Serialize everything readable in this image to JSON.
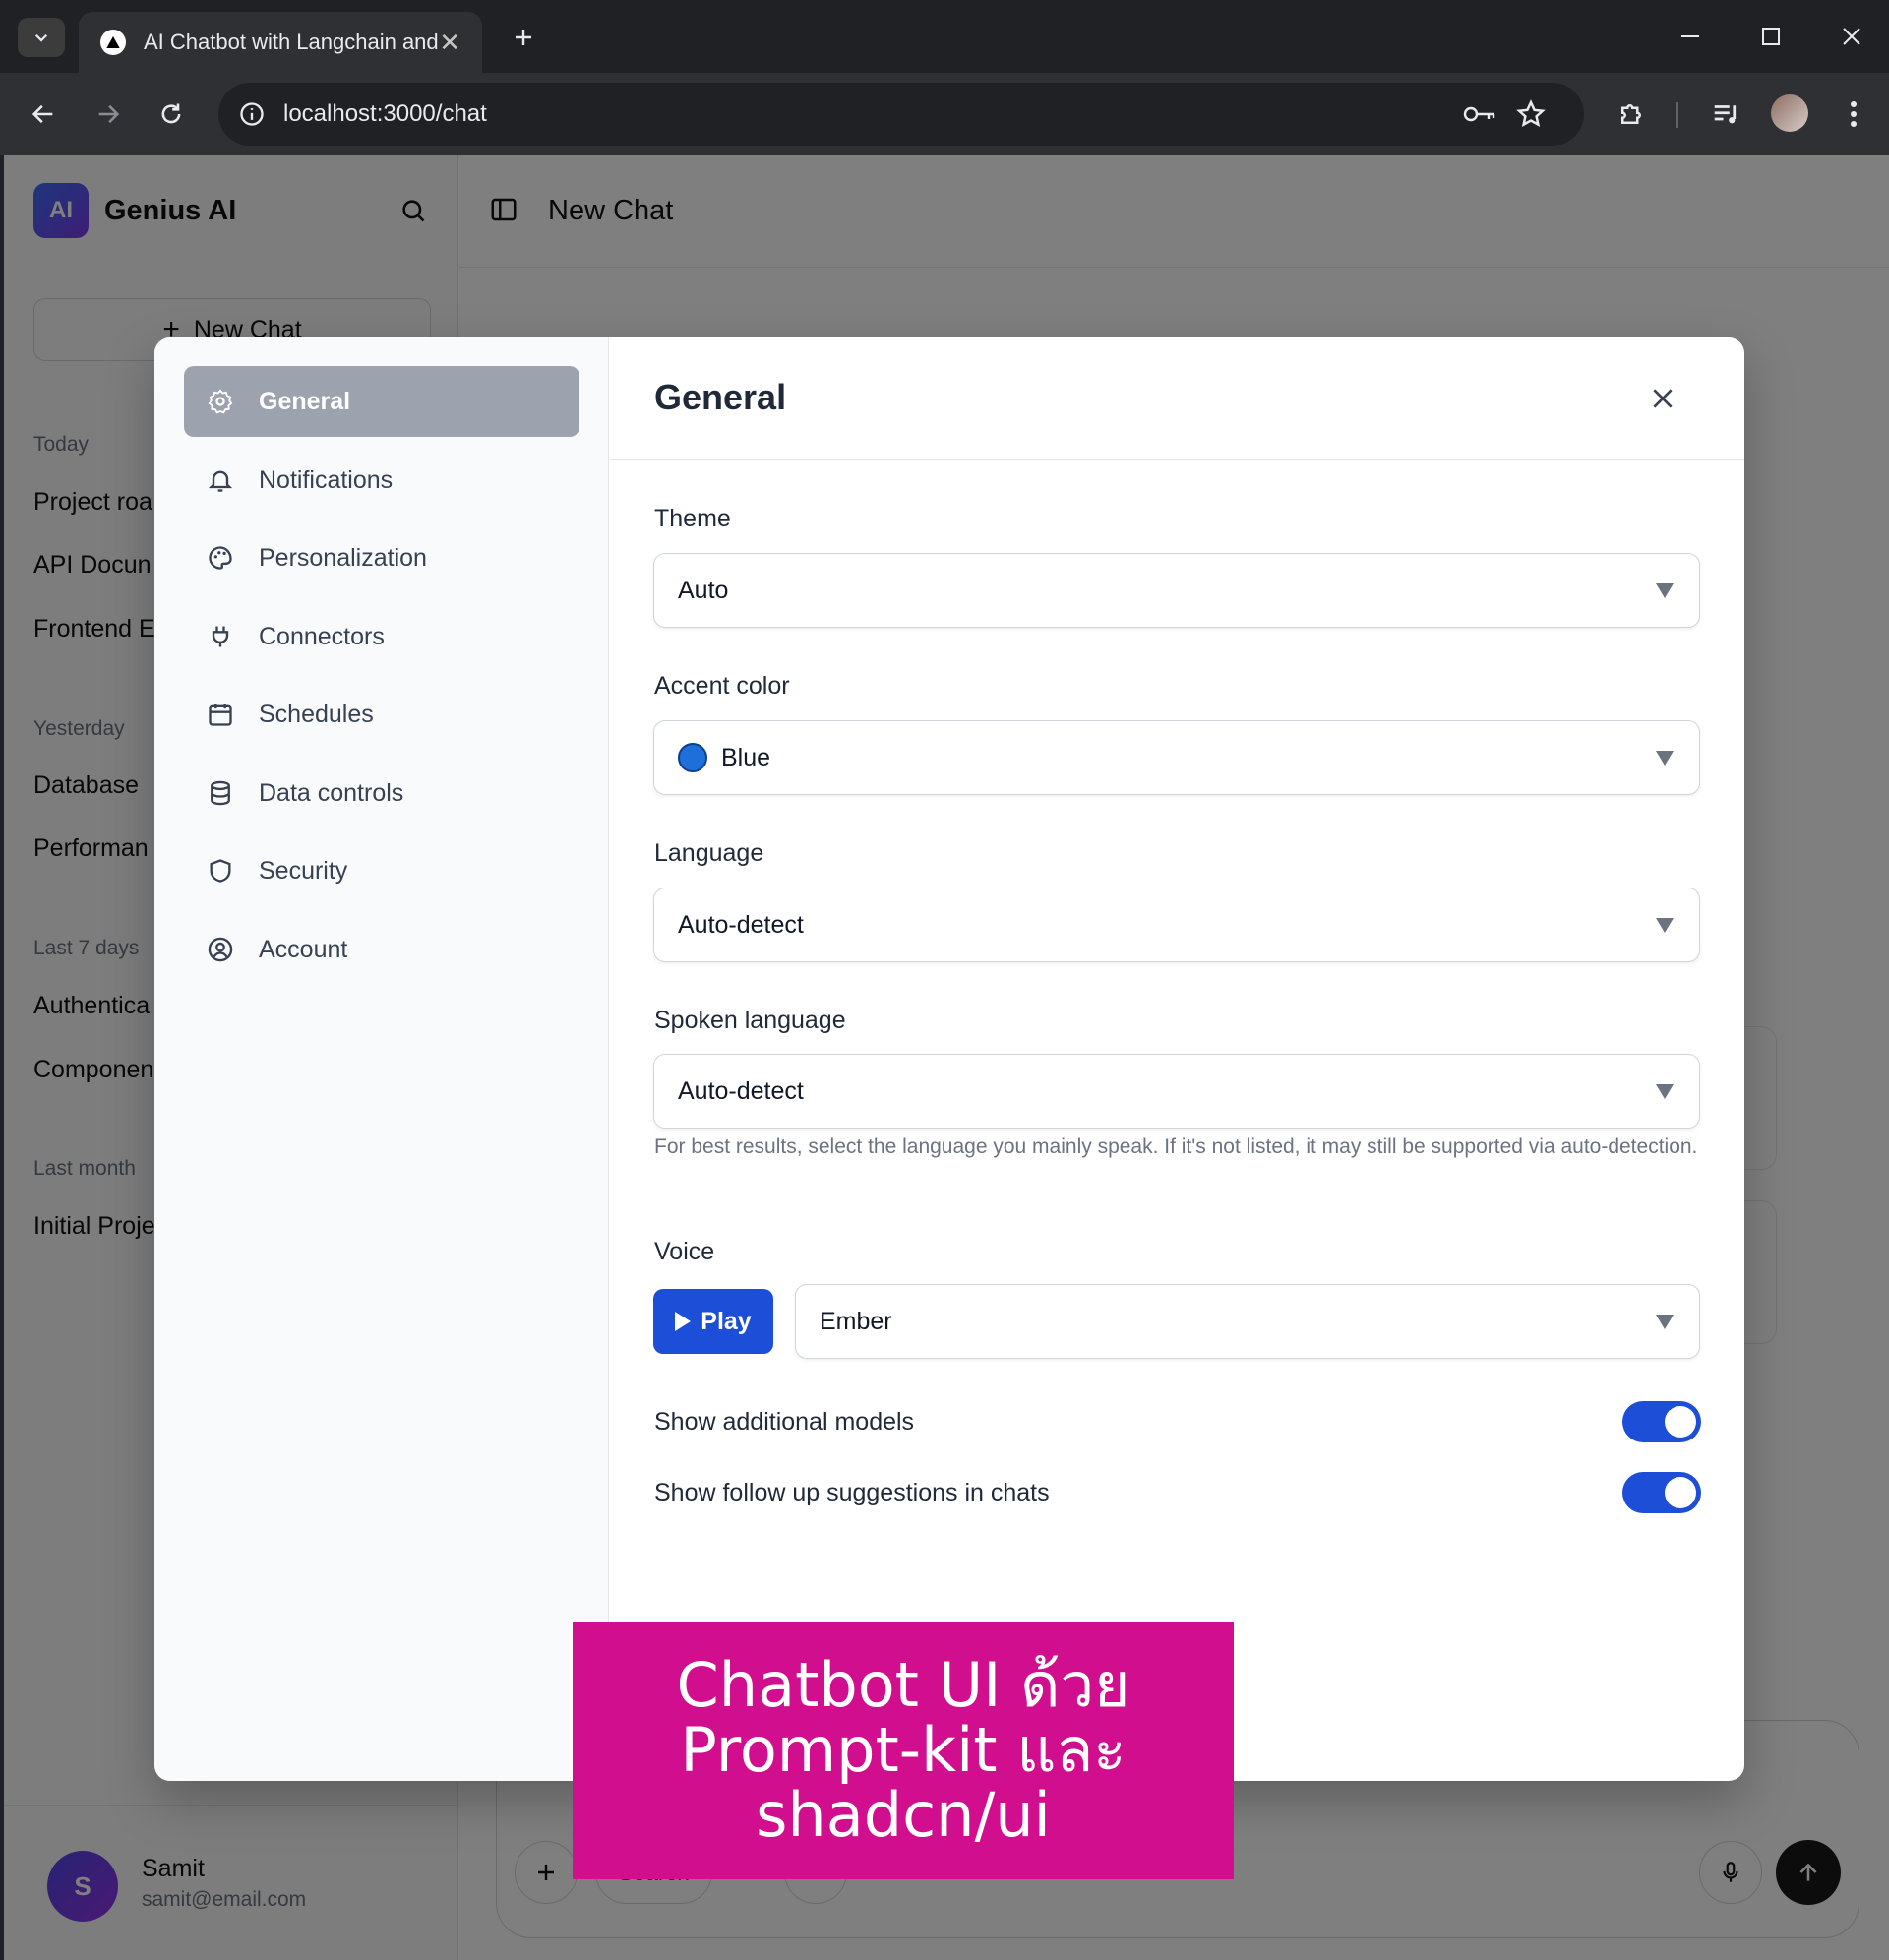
{
  "browser": {
    "tab_title": "AI Chatbot with Langchain and",
    "tab_close": "✕",
    "new_tab": "+",
    "url": "localhost:3000/chat"
  },
  "sidebar": {
    "logo_text": "AI",
    "brand": "Genius AI",
    "new_chat_label": "New Chat",
    "new_chat_plus": "+",
    "groups": [
      {
        "label": "Today",
        "items": [
          "Project roa",
          "API Docun",
          "Frontend E"
        ]
      },
      {
        "label": "Yesterday",
        "items": [
          "Database",
          "Performan"
        ]
      },
      {
        "label": "Last 7 days",
        "items": [
          "Authentica",
          "Componen"
        ]
      },
      {
        "label": "Last month",
        "items": [
          "Initial Proje"
        ]
      }
    ],
    "user": {
      "initial": "S",
      "name": "Samit",
      "email": "samit@email.com"
    }
  },
  "main": {
    "title": "New Chat",
    "composer_pill": "Search"
  },
  "settings": {
    "title": "General",
    "nav": [
      {
        "label": "General",
        "icon": "gear-icon",
        "active": true
      },
      {
        "label": "Notifications",
        "icon": "bell-icon"
      },
      {
        "label": "Personalization",
        "icon": "palette-icon"
      },
      {
        "label": "Connectors",
        "icon": "plug-icon"
      },
      {
        "label": "Schedules",
        "icon": "calendar-icon"
      },
      {
        "label": "Data controls",
        "icon": "database-icon"
      },
      {
        "label": "Security",
        "icon": "shield-icon"
      },
      {
        "label": "Account",
        "icon": "user-circle-icon"
      }
    ],
    "fields": {
      "theme": {
        "label": "Theme",
        "value": "Auto"
      },
      "accent": {
        "label": "Accent color",
        "value": "Blue",
        "swatch": "#1e6fd9"
      },
      "language": {
        "label": "Language",
        "value": "Auto-detect"
      },
      "spoken": {
        "label": "Spoken language",
        "value": "Auto-detect",
        "hint": "For best results, select the language you mainly speak. If it's not listed, it may still be supported via auto-detection."
      },
      "voice": {
        "label": "Voice",
        "play_label": "Play",
        "value": "Ember"
      }
    },
    "toggles": [
      {
        "label": "Show additional models",
        "on": true
      },
      {
        "label": "Show follow up suggestions in chats",
        "on": true
      }
    ]
  },
  "banner": {
    "line1": "Chatbot UI ด้วย",
    "line2": "Prompt-kit และ",
    "line3": "shadcn/ui"
  },
  "colors": {
    "accent": "#1d4ed8",
    "banner": "#d10f8e",
    "nav_active": "#9ca3af"
  }
}
